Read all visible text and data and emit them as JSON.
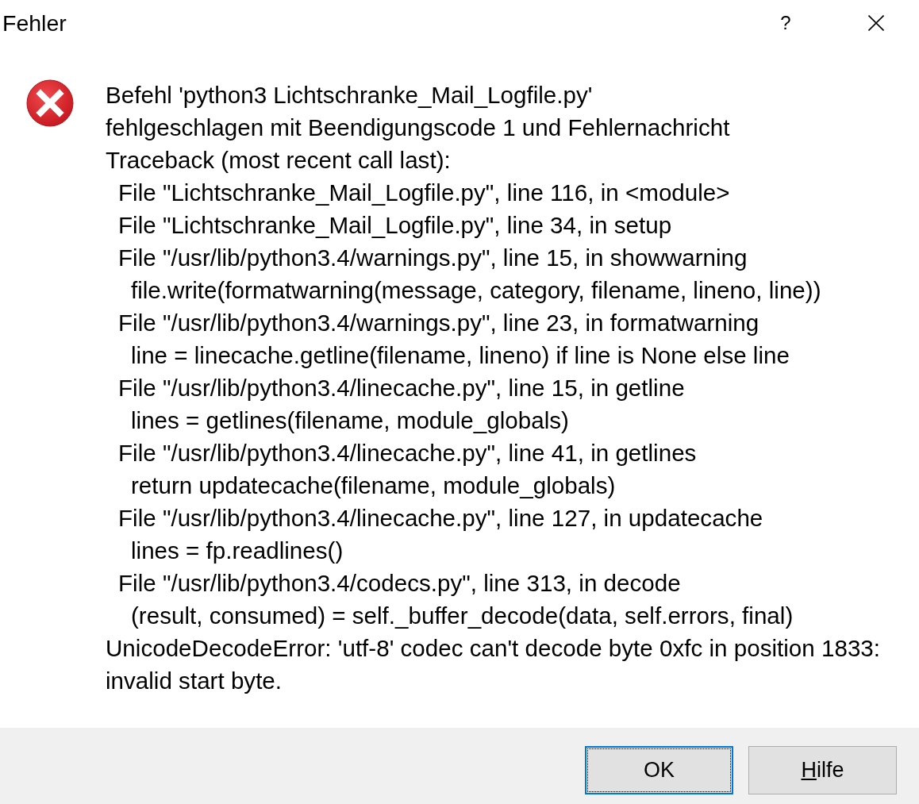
{
  "window": {
    "title": "Fehler",
    "help_glyph": "?"
  },
  "message": {
    "lines": [
      {
        "text": "Befehl 'python3 Lichtschranke_Mail_Logfile.py'"
      },
      {
        "text": "fehlgeschlagen mit Beendigungscode 1 und Fehlernachricht"
      },
      {
        "text": "Traceback (most recent call last):",
        "children": [
          {
            "text": "File \"Lichtschranke_Mail_Logfile.py\", line 116, in <module>"
          },
          {
            "text": "File \"Lichtschranke_Mail_Logfile.py\", line 34, in setup"
          },
          {
            "text": "File \"/usr/lib/python3.4/warnings.py\", line 15, in showwarning",
            "children": [
              {
                "text": "file.write(formatwarning(message, category, filename, lineno, line))"
              }
            ]
          },
          {
            "text": "File \"/usr/lib/python3.4/warnings.py\", line 23, in formatwarning",
            "children": [
              {
                "text": "line = linecache.getline(filename, lineno) if line is None else line"
              }
            ]
          },
          {
            "text": "File \"/usr/lib/python3.4/linecache.py\", line 15, in getline",
            "children": [
              {
                "text": "lines = getlines(filename, module_globals)"
              }
            ]
          },
          {
            "text": "File \"/usr/lib/python3.4/linecache.py\", line 41, in getlines",
            "children": [
              {
                "text": "return updatecache(filename, module_globals)"
              }
            ]
          },
          {
            "text": "File \"/usr/lib/python3.4/linecache.py\", line 127, in updatecache",
            "children": [
              {
                "text": "lines = fp.readlines()"
              }
            ]
          },
          {
            "text": "File \"/usr/lib/python3.4/codecs.py\", line 313, in decode",
            "children": [
              {
                "text": "(result, consumed) = self._buffer_decode(data, self.errors, final)"
              }
            ]
          }
        ]
      },
      {
        "text": "UnicodeDecodeError: 'utf-8' codec can't decode byte 0xfc in position 1833:"
      },
      {
        "text": "invalid start byte."
      }
    ]
  },
  "buttons": [
    {
      "label": "OK",
      "focused": true,
      "mnemonic_underlined": false
    },
    {
      "label": "Hilfe",
      "focused": false,
      "mnemonic_underlined": true
    }
  ]
}
